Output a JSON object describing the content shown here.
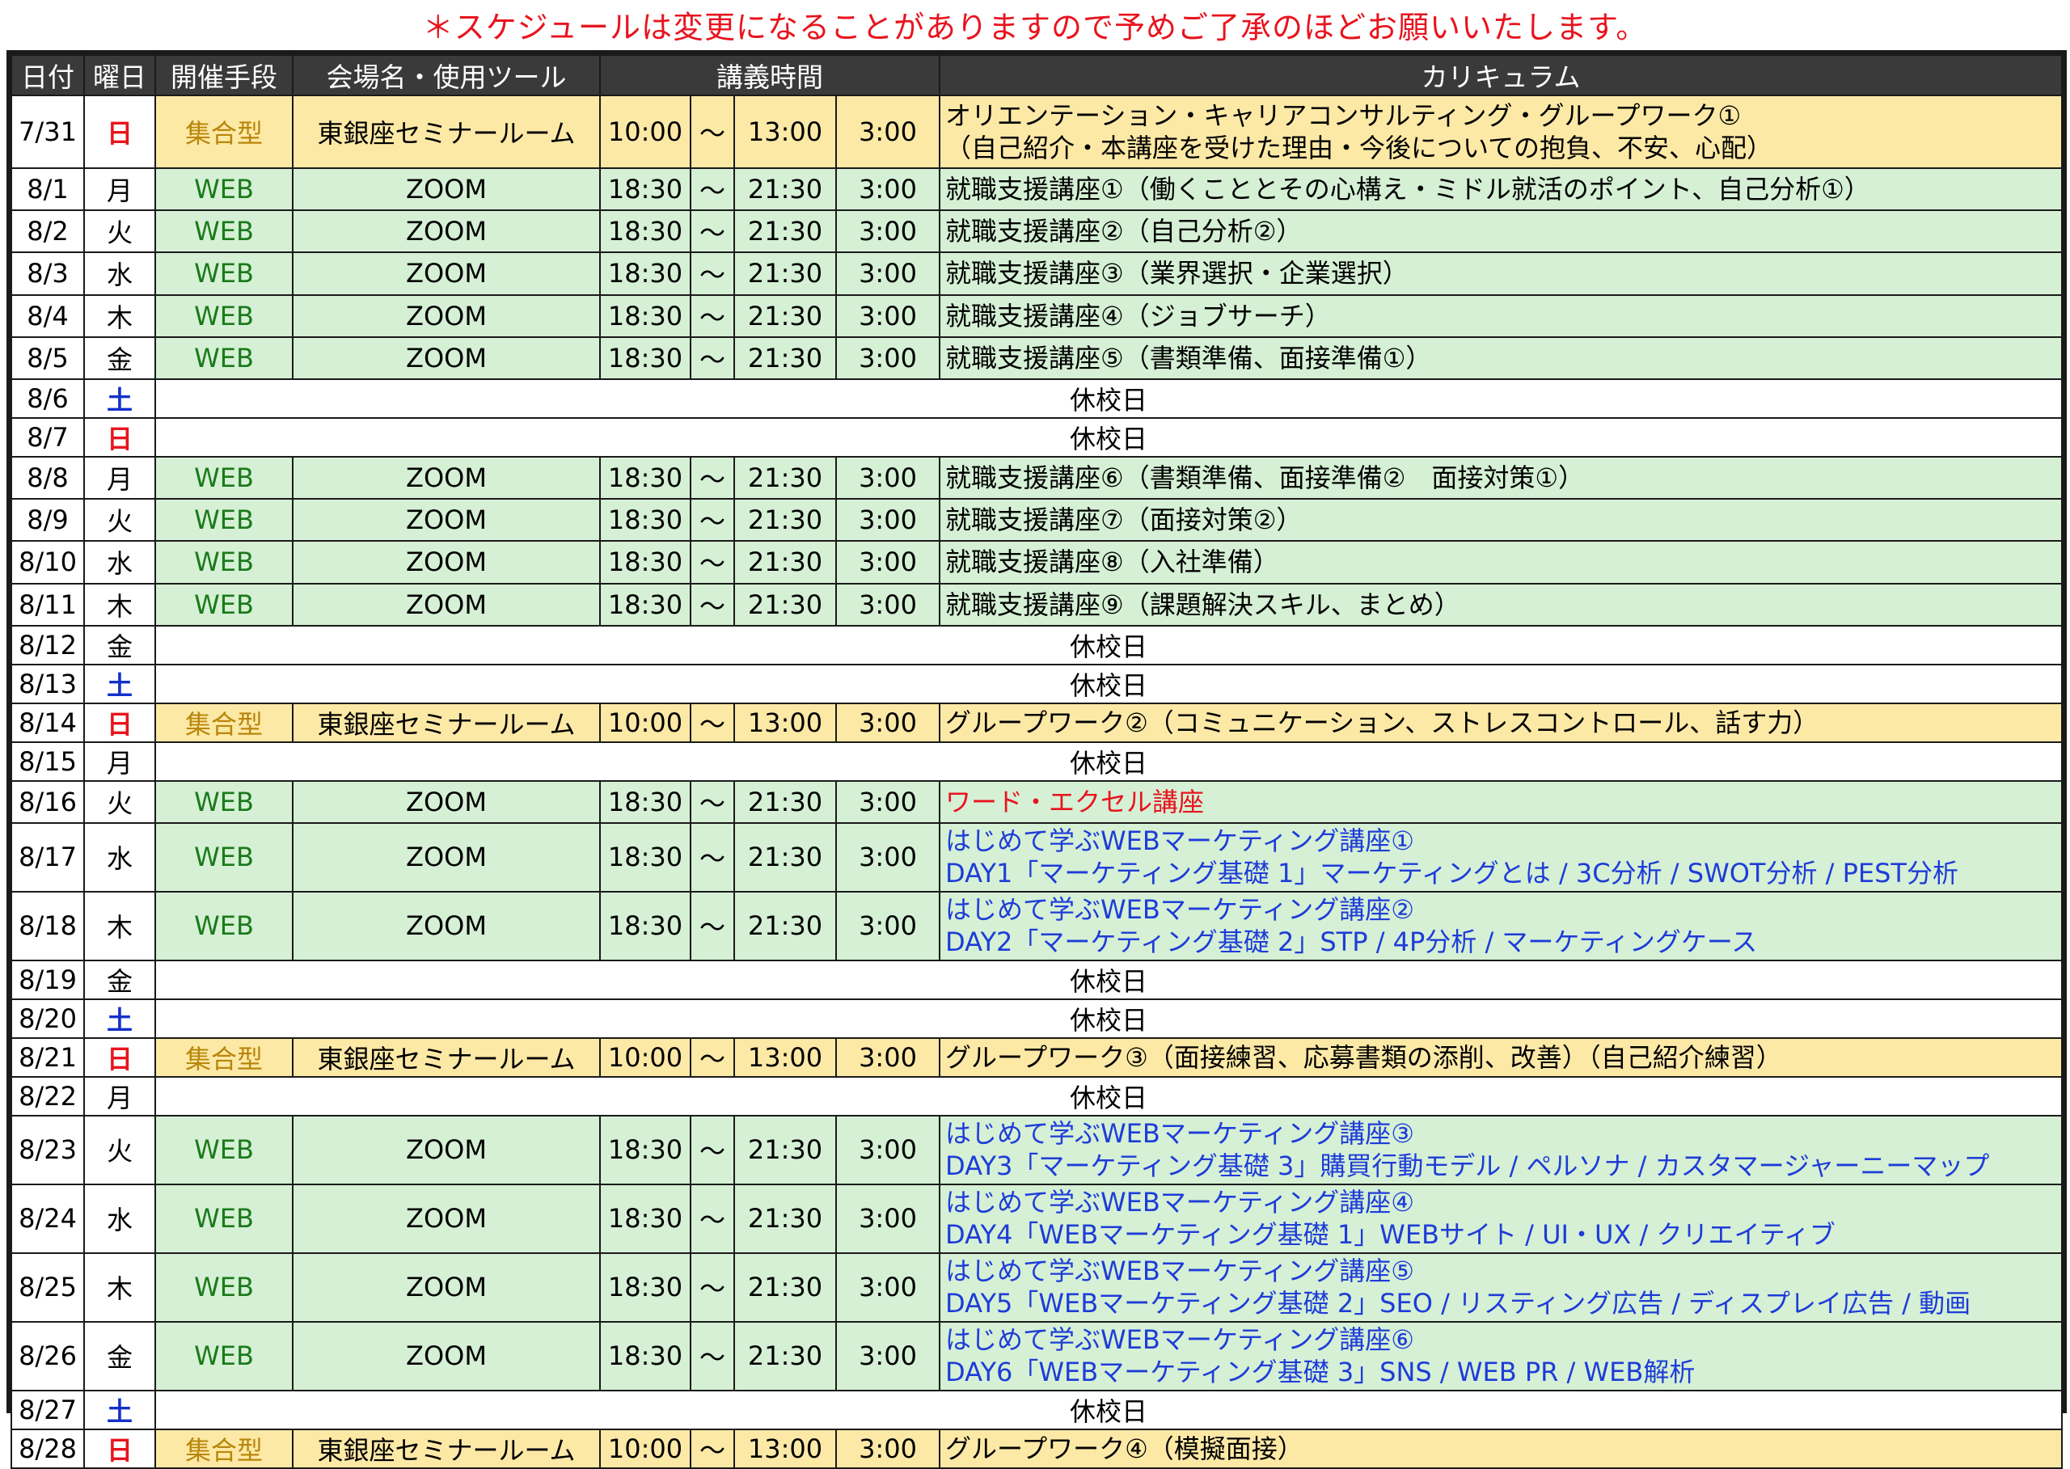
{
  "notice": "＊スケジュールは変更になることがありますので予めご了承のほどお願いいたします。",
  "headers": {
    "date": "日付",
    "dow": "曜日",
    "method": "開催手段",
    "venue": "会場名・使用ツール",
    "time": "講義時間",
    "curriculum": "カリキュラム"
  },
  "holiday_text": "休校日",
  "rows": [
    {
      "date": "7/31",
      "dow": "日",
      "type": "group",
      "method": "集合型",
      "venue": "東銀座セミナールーム",
      "start": "10:00",
      "tilde": "～",
      "end": "13:00",
      "dur": "3:00",
      "lines": [
        "オリエンテーション・キャリアコンサルティング・グループワーク①",
        "（自己紹介・本講座を受けた理由・今後についての抱負、不安、心配）"
      ],
      "color": "black"
    },
    {
      "date": "8/1",
      "dow": "月",
      "type": "web",
      "method": "WEB",
      "venue": "ZOOM",
      "start": "18:30",
      "tilde": "～",
      "end": "21:30",
      "dur": "3:00",
      "lines": [
        "就職支援講座①（働くこととその心構え・ミドル就活のポイント、自己分析①）"
      ],
      "color": "black"
    },
    {
      "date": "8/2",
      "dow": "火",
      "type": "web",
      "method": "WEB",
      "venue": "ZOOM",
      "start": "18:30",
      "tilde": "～",
      "end": "21:30",
      "dur": "3:00",
      "lines": [
        "就職支援講座②（自己分析②）"
      ],
      "color": "black"
    },
    {
      "date": "8/3",
      "dow": "水",
      "type": "web",
      "method": "WEB",
      "venue": "ZOOM",
      "start": "18:30",
      "tilde": "～",
      "end": "21:30",
      "dur": "3:00",
      "lines": [
        "就職支援講座③（業界選択・企業選択）"
      ],
      "color": "black"
    },
    {
      "date": "8/4",
      "dow": "木",
      "type": "web",
      "method": "WEB",
      "venue": "ZOOM",
      "start": "18:30",
      "tilde": "～",
      "end": "21:30",
      "dur": "3:00",
      "lines": [
        "就職支援講座④（ジョブサーチ）"
      ],
      "color": "black"
    },
    {
      "date": "8/5",
      "dow": "金",
      "type": "web",
      "method": "WEB",
      "venue": "ZOOM",
      "start": "18:30",
      "tilde": "～",
      "end": "21:30",
      "dur": "3:00",
      "lines": [
        "就職支援講座⑤（書類準備、面接準備①）"
      ],
      "color": "black"
    },
    {
      "date": "8/6",
      "dow": "土",
      "type": "holiday"
    },
    {
      "date": "8/7",
      "dow": "日",
      "type": "holiday"
    },
    {
      "date": "8/8",
      "dow": "月",
      "type": "web",
      "method": "WEB",
      "venue": "ZOOM",
      "start": "18:30",
      "tilde": "～",
      "end": "21:30",
      "dur": "3:00",
      "lines": [
        "就職支援講座⑥（書類準備、面接準備②　面接対策①）"
      ],
      "color": "black"
    },
    {
      "date": "8/9",
      "dow": "火",
      "type": "web",
      "method": "WEB",
      "venue": "ZOOM",
      "start": "18:30",
      "tilde": "～",
      "end": "21:30",
      "dur": "3:00",
      "lines": [
        "就職支援講座⑦（面接対策②）"
      ],
      "color": "black"
    },
    {
      "date": "8/10",
      "dow": "水",
      "type": "web",
      "method": "WEB",
      "venue": "ZOOM",
      "start": "18:30",
      "tilde": "～",
      "end": "21:30",
      "dur": "3:00",
      "lines": [
        "就職支援講座⑧（入社準備）"
      ],
      "color": "black"
    },
    {
      "date": "8/11",
      "dow": "木",
      "type": "web",
      "method": "WEB",
      "venue": "ZOOM",
      "start": "18:30",
      "tilde": "～",
      "end": "21:30",
      "dur": "3:00",
      "lines": [
        "就職支援講座⑨（課題解決スキル、まとめ）"
      ],
      "color": "black"
    },
    {
      "date": "8/12",
      "dow": "金",
      "type": "holiday"
    },
    {
      "date": "8/13",
      "dow": "土",
      "type": "holiday"
    },
    {
      "date": "8/14",
      "dow": "日",
      "type": "group",
      "method": "集合型",
      "venue": "東銀座セミナールーム",
      "start": "10:00",
      "tilde": "～",
      "end": "13:00",
      "dur": "3:00",
      "lines": [
        "グループワーク②（コミュニケーション、ストレスコントロール、話す力）"
      ],
      "color": "black"
    },
    {
      "date": "8/15",
      "dow": "月",
      "type": "holiday"
    },
    {
      "date": "8/16",
      "dow": "火",
      "type": "web",
      "method": "WEB",
      "venue": "ZOOM",
      "start": "18:30",
      "tilde": "～",
      "end": "21:30",
      "dur": "3:00",
      "lines": [
        "ワード・エクセル講座"
      ],
      "color": "red"
    },
    {
      "date": "8/17",
      "dow": "水",
      "type": "web",
      "method": "WEB",
      "venue": "ZOOM",
      "start": "18:30",
      "tilde": "～",
      "end": "21:30",
      "dur": "3:00",
      "lines": [
        "はじめて学ぶWEBマーケティング講座①",
        "DAY1「マーケティング基礎 1」マーケティングとは / 3C分析 / SWOT分析 / PEST分析"
      ],
      "color": "blue"
    },
    {
      "date": "8/18",
      "dow": "木",
      "type": "web",
      "method": "WEB",
      "venue": "ZOOM",
      "start": "18:30",
      "tilde": "～",
      "end": "21:30",
      "dur": "3:00",
      "lines": [
        "はじめて学ぶWEBマーケティング講座②",
        "DAY2「マーケティング基礎 2」STP / 4P分析 / マーケティングケース"
      ],
      "color": "blue"
    },
    {
      "date": "8/19",
      "dow": "金",
      "type": "holiday"
    },
    {
      "date": "8/20",
      "dow": "土",
      "type": "holiday"
    },
    {
      "date": "8/21",
      "dow": "日",
      "type": "group",
      "method": "集合型",
      "venue": "東銀座セミナールーム",
      "start": "10:00",
      "tilde": "～",
      "end": "13:00",
      "dur": "3:00",
      "lines": [
        "グループワーク③（面接練習、応募書類の添削、改善）（自己紹介練習）"
      ],
      "color": "black"
    },
    {
      "date": "8/22",
      "dow": "月",
      "type": "holiday"
    },
    {
      "date": "8/23",
      "dow": "火",
      "type": "web",
      "method": "WEB",
      "venue": "ZOOM",
      "start": "18:30",
      "tilde": "～",
      "end": "21:30",
      "dur": "3:00",
      "lines": [
        "はじめて学ぶWEBマーケティング講座③",
        "DAY3「マーケティング基礎 3」購買行動モデル / ペルソナ / カスタマージャーニーマップ"
      ],
      "color": "blue"
    },
    {
      "date": "8/24",
      "dow": "水",
      "type": "web",
      "method": "WEB",
      "venue": "ZOOM",
      "start": "18:30",
      "tilde": "～",
      "end": "21:30",
      "dur": "3:00",
      "lines": [
        "はじめて学ぶWEBマーケティング講座④",
        "DAY4「WEBマーケティング基礎 1」WEBサイト / UI・UX / クリエイティブ"
      ],
      "color": "blue"
    },
    {
      "date": "8/25",
      "dow": "木",
      "type": "web",
      "method": "WEB",
      "venue": "ZOOM",
      "start": "18:30",
      "tilde": "～",
      "end": "21:30",
      "dur": "3:00",
      "lines": [
        "はじめて学ぶWEBマーケティング講座⑤",
        "DAY5「WEBマーケティング基礎 2」SEO / リスティング広告 / ディスプレイ広告 / 動画"
      ],
      "color": "blue"
    },
    {
      "date": "8/26",
      "dow": "金",
      "type": "web",
      "method": "WEB",
      "venue": "ZOOM",
      "start": "18:30",
      "tilde": "～",
      "end": "21:30",
      "dur": "3:00",
      "lines": [
        "はじめて学ぶWEBマーケティング講座⑥",
        "DAY6「WEBマーケティング基礎 3」SNS / WEB PR / WEB解析"
      ],
      "color": "blue"
    },
    {
      "date": "8/27",
      "dow": "土",
      "type": "holiday"
    },
    {
      "date": "8/28",
      "dow": "日",
      "type": "group",
      "method": "集合型",
      "venue": "東銀座セミナールーム",
      "start": "10:00",
      "tilde": "～",
      "end": "13:00",
      "dur": "3:00",
      "lines": [
        "グループワーク④（模擬面接）"
      ],
      "color": "black"
    }
  ]
}
